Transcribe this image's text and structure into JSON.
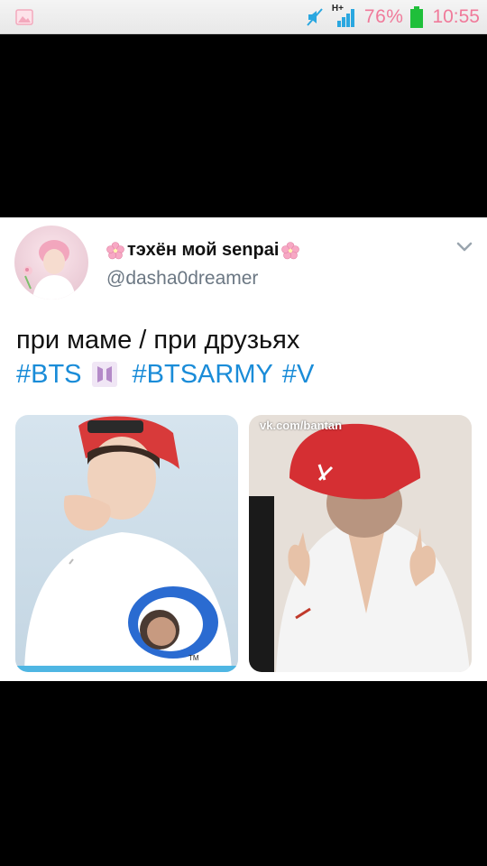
{
  "status_bar": {
    "battery_percent": "76%",
    "time": "10:55",
    "network": "H+"
  },
  "tweet": {
    "display_name": "тэхён мой senpai",
    "handle": "@dasha0dreamer",
    "text": "при маме / при друзьях",
    "hashtags": [
      "#BTS",
      "#BTSARMY",
      "#V"
    ],
    "images": [
      {
        "alt": "photo-left"
      },
      {
        "alt": "photo-right",
        "watermark": "vk.com/bantan"
      }
    ]
  },
  "colors": {
    "link": "#1a8cd8",
    "status_text": "#f07a9a",
    "handle": "#6b7783"
  },
  "icons": [
    "image-icon",
    "mute-icon",
    "signal-icon",
    "battery-icon",
    "sakura-icon",
    "chevron-down-icon",
    "bts-logo-icon"
  ]
}
